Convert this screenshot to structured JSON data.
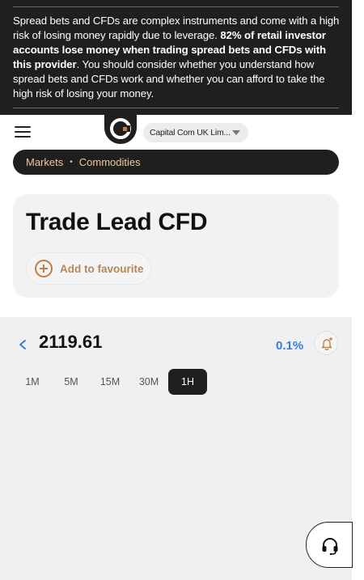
{
  "risk_warning": {
    "text_part1": "Spread bets and CFDs are complex instruments and come with a high risk of losing money rapidly due to leverage. ",
    "text_bold": "82% of retail investor accounts lose money when trading spread bets and CFDs with this provider",
    "text_part2": ". You should consider whether you understand how spread bets and CFDs work and whether you can afford to take the high risk of losing your money."
  },
  "header": {
    "menu_icon": "hamburger-menu-icon",
    "logo_icon": "capital-com-logo",
    "entity_select": "Capital Com UK Lim..."
  },
  "breadcrumb": {
    "items": [
      "Markets",
      "Commodities"
    ],
    "separator": "•"
  },
  "instrument": {
    "title": "Trade Lead CFD",
    "favourite_label": "Add to favourite"
  },
  "price_panel": {
    "price": "2119.61",
    "change": "0.1%",
    "timeframes": [
      "1M",
      "5M",
      "15M",
      "30M",
      "1H"
    ],
    "active_timeframe": "1H"
  },
  "colors": {
    "dark": "#1f1f1f",
    "accent_orange": "#c47c3f",
    "breadcrumb_text": "#f0c79b",
    "change_blue": "#3d7bd9",
    "panel_bg": "#eff0f2"
  }
}
